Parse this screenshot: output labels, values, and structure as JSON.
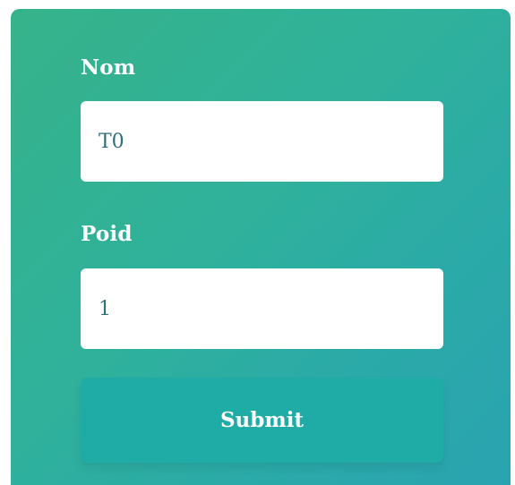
{
  "form": {
    "fields": [
      {
        "label": "Nom",
        "value": "T0"
      },
      {
        "label": "Poid",
        "value": "1"
      }
    ],
    "submit_label": "Submit"
  },
  "colors": {
    "gradient_start": "#36b38a",
    "gradient_end": "#2aa3b0",
    "button": "#1faca6",
    "input_background": "#ffffff",
    "input_text": "#2f6f76",
    "label_text": "#ffffff"
  }
}
